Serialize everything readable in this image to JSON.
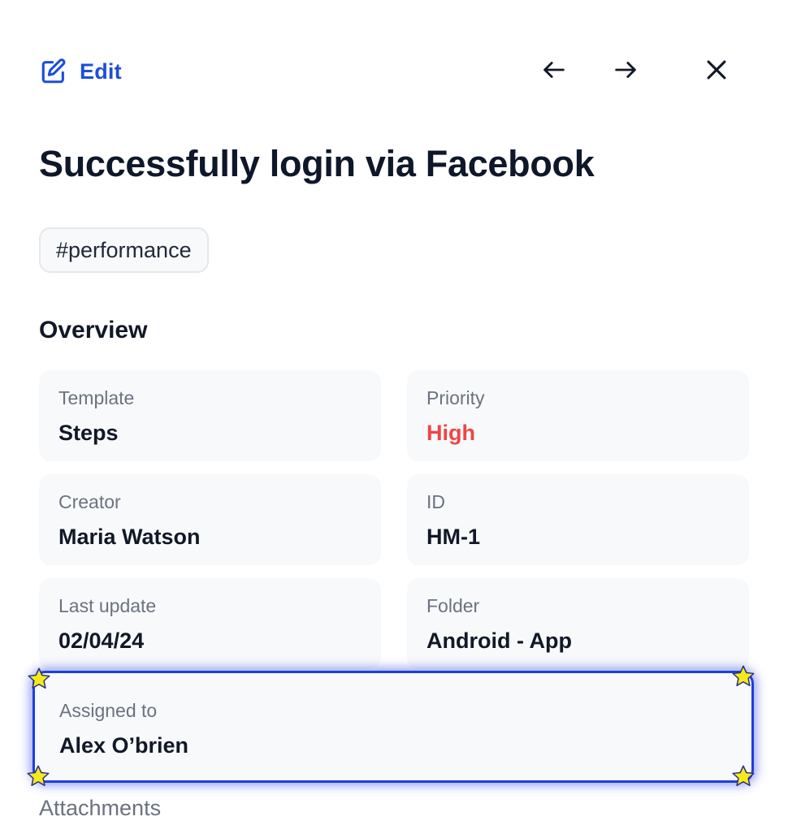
{
  "header": {
    "edit_label": "Edit",
    "icons": {
      "edit": "edit-pencil-icon",
      "prev": "arrow-left-icon",
      "next": "arrow-right-icon",
      "close": "close-icon"
    }
  },
  "title": "Successfully login via Facebook",
  "tag": "#performance",
  "overview": {
    "heading": "Overview",
    "fields": {
      "template": {
        "label": "Template",
        "value": "Steps"
      },
      "priority": {
        "label": "Priority",
        "value": "High"
      },
      "creator": {
        "label": "Creator",
        "value": "Maria Watson"
      },
      "id": {
        "label": "ID",
        "value": "HM-1"
      },
      "last_update": {
        "label": "Last update",
        "value": "02/04/24"
      },
      "folder": {
        "label": "Folder",
        "value": "Android - App"
      },
      "assigned_to": {
        "label": "Assigned to",
        "value": "Alex O’brien"
      }
    }
  },
  "attachments_label": "Attachments",
  "colors": {
    "accent": "#1d4ed8",
    "priority_high": "#ef4444",
    "highlight_border": "#1d3ee0",
    "star": "#f5ea1a",
    "card_bg": "#f8f9fb"
  }
}
